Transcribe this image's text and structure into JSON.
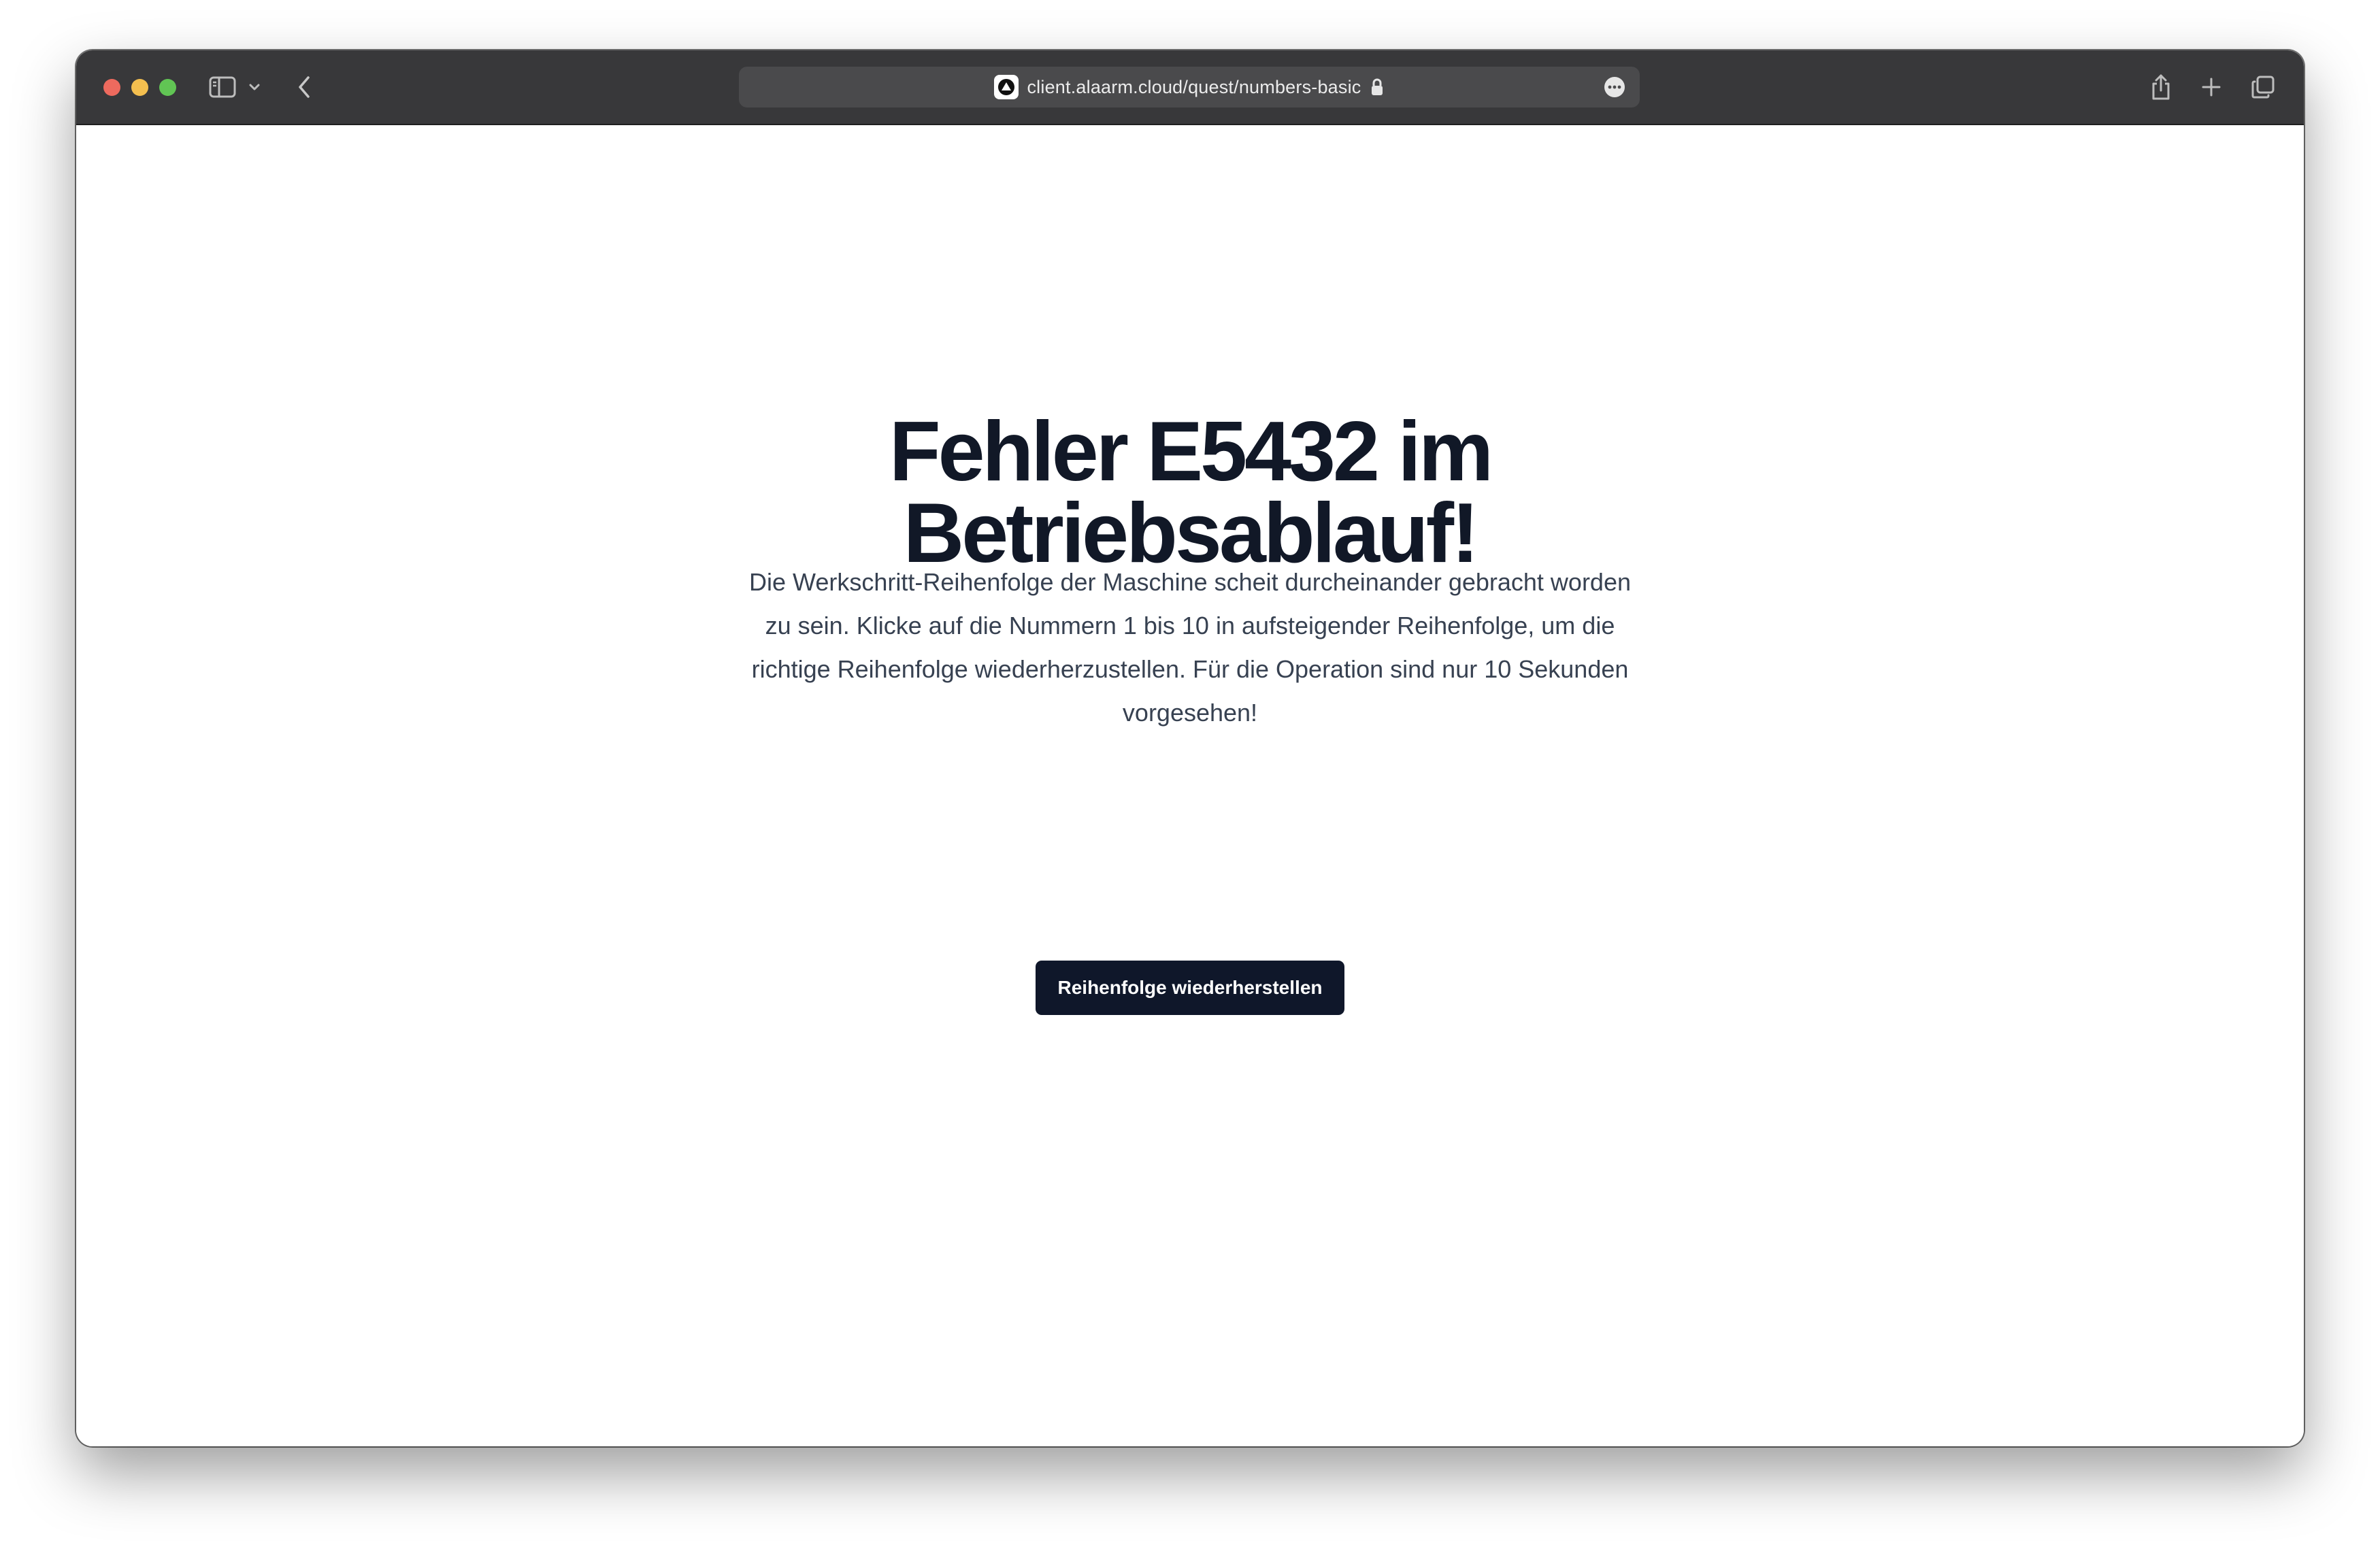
{
  "browser": {
    "url": "client.alaarm.cloud/quest/numbers-basic",
    "icons": {
      "close": "close-traffic-light",
      "minimize": "minimize-traffic-light",
      "zoom": "zoom-traffic-light",
      "sidebar": "sidebar-icon",
      "sidebar_menu": "chevron-down-icon",
      "back": "chevron-left-icon",
      "site": "site-favicon",
      "lock": "lock-icon",
      "more": "ellipsis-circle-icon",
      "share": "share-icon",
      "new_tab": "plus-icon",
      "tabs": "tab-overview-icon"
    },
    "colors": {
      "titlebar": "#38383a",
      "urlbar": "#4a4a4c",
      "close": "#ed6a5e",
      "minimize": "#f4bf4f",
      "zoom": "#61c554"
    }
  },
  "page": {
    "heading_line1": "Fehler E5432 im",
    "heading_line2": "Betriebsablauf!",
    "description": "Die Werkschritt-Reihenfolge der Maschine scheit durcheinander gebracht worden zu sein. Klicke auf die Nummern 1 bis 10 in aufsteigender Reihenfolge, um die richtige Reihenfolge wiederherzustellen. Für die Operation sind nur 10 Sekunden vorgesehen!",
    "button_label": "Reihenfolge wiederherstellen",
    "colors": {
      "heading": "#111827",
      "text": "#374151",
      "button_bg": "#0f172a",
      "button_text": "#ffffff"
    }
  }
}
